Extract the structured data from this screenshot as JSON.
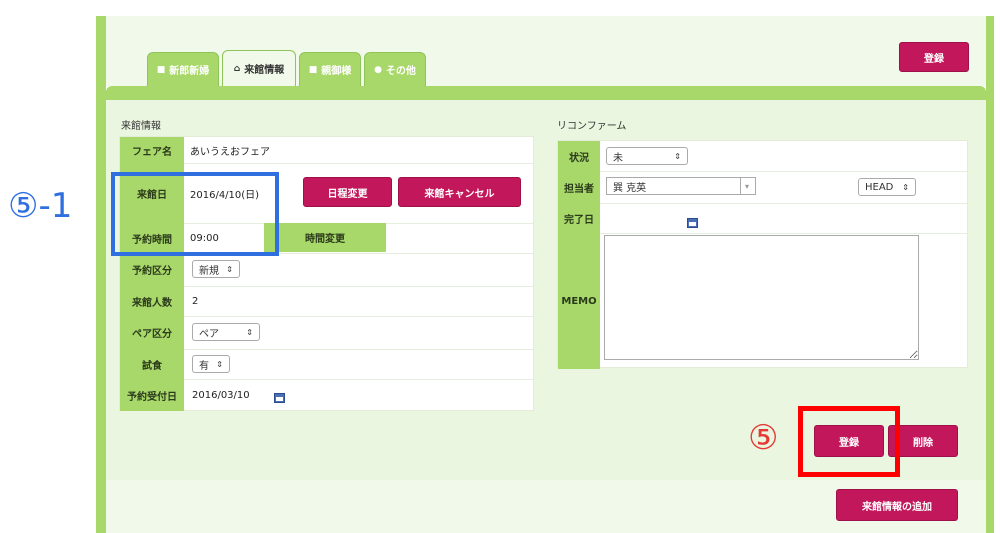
{
  "tabs": [
    {
      "label": "新郎新婦",
      "icon": "person-icon",
      "active": false
    },
    {
      "label": "来館情報",
      "icon": "home-icon",
      "active": true
    },
    {
      "label": "親御様",
      "icon": "person-icon",
      "active": false
    },
    {
      "label": "その他",
      "icon": "info-icon",
      "active": false
    }
  ],
  "header": {
    "register_label": "登録"
  },
  "visit": {
    "title": "来館情報",
    "fair_label": "フェア名",
    "fair_value": "あいうえおフェア",
    "date_label": "来館日",
    "date_value": "2016/4/10(日)",
    "date_change_label": "日程変更",
    "cancel_label": "来館キャンセル",
    "time_label": "予約時間",
    "time_value": "09:00",
    "time_change_label": "時間変更",
    "type_label": "予約区分",
    "type_value": "新規",
    "people_label": "来館人数",
    "people_value": "2",
    "pair_label": "ペア区分",
    "pair_value": "ペア",
    "tasting_label": "試食",
    "tasting_value": "有",
    "received_label": "予約受付日",
    "received_value": "2016/03/10"
  },
  "reconfirm": {
    "title": "リコンファーム",
    "status_label": "状況",
    "status_value": "未",
    "staff_label": "担当者",
    "staff_value": "巽 克英",
    "role_value": "HEAD",
    "done_label": "完了日",
    "memo_label": "MEMO",
    "memo_value": ""
  },
  "actions": {
    "register_label": "登録",
    "delete_label": "削除",
    "add_visit_label": "来館情報の追加"
  },
  "annotations": {
    "blue": "⑤-1",
    "red": "⑤"
  },
  "colors": {
    "accent_green": "#a8d86a",
    "button_pink": "#c2185b",
    "highlight_blue": "#2f6fe0",
    "highlight_red": "#ff0000"
  }
}
